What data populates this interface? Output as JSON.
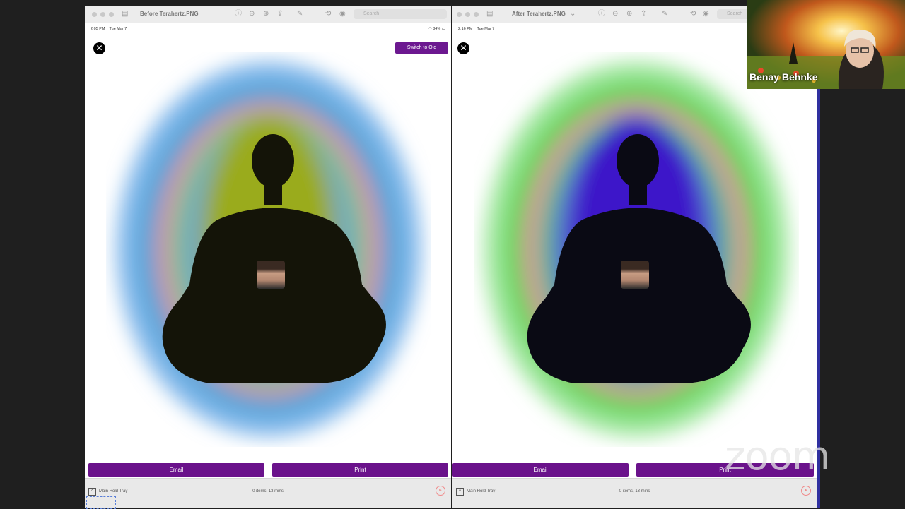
{
  "left_window": {
    "title": "Before Terahertz.PNG",
    "search_placeholder": "Search",
    "status_time": "2:05 PM",
    "status_date": "Tue Mar 7",
    "battery": "84%",
    "switch_button": "Switch to Old",
    "email_button": "Email",
    "print_button": "Print",
    "tray_label": "Main Hold Tray",
    "items_count": "0 items, 13 mins"
  },
  "right_window": {
    "title": "After Terahertz.PNG",
    "search_placeholder": "Search",
    "status_time": "2:16 PM",
    "status_date": "Tue Mar 7",
    "email_button": "Email",
    "print_button": "Print",
    "tray_label": "Main Hold Tray",
    "items_count": "0 items, 13 mins"
  },
  "video_tile": {
    "participant_name": "Benay Behnke"
  },
  "watermark": "zoom",
  "colors": {
    "accent_purple": "#6a128b",
    "left_aura_core": "#9aab1e",
    "right_aura_core": "#3e17c9"
  }
}
